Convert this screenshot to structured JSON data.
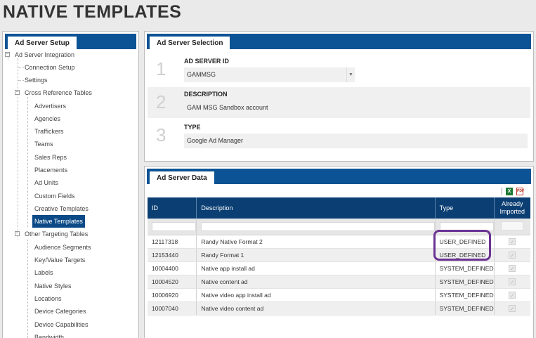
{
  "page": {
    "title": "NATIVE TEMPLATES"
  },
  "sidebar": {
    "tab": "Ad Server Setup",
    "items": [
      {
        "label": "Ad Server Integration",
        "level": 1,
        "toggle": "−"
      },
      {
        "label": "Connection Setup",
        "level": 2
      },
      {
        "label": "Settings",
        "level": 2
      },
      {
        "label": "Cross Reference Tables",
        "level": 2,
        "toggle": "−"
      },
      {
        "label": "Advertisers",
        "level": 3
      },
      {
        "label": "Agencies",
        "level": 3
      },
      {
        "label": "Traffickers",
        "level": 3
      },
      {
        "label": "Teams",
        "level": 3
      },
      {
        "label": "Sales Reps",
        "level": 3
      },
      {
        "label": "Placements",
        "level": 3
      },
      {
        "label": "Ad Units",
        "level": 3
      },
      {
        "label": "Custom Fields",
        "level": 3
      },
      {
        "label": "Creative Templates",
        "level": 3
      },
      {
        "label": "Native Templates",
        "level": 3,
        "selected": true
      },
      {
        "label": "Other Targeting Tables",
        "level": 2,
        "toggle": "−"
      },
      {
        "label": "Audience Segments",
        "level": 3
      },
      {
        "label": "Key/Value Targets",
        "level": 3
      },
      {
        "label": "Labels",
        "level": 3
      },
      {
        "label": "Native Styles",
        "level": 3
      },
      {
        "label": "Locations",
        "level": 3
      },
      {
        "label": "Device Categories",
        "level": 3
      },
      {
        "label": "Device Capabilities",
        "level": 3
      },
      {
        "label": "Bandwidth",
        "level": 3
      }
    ]
  },
  "selection": {
    "tab": "Ad Server Selection",
    "fields": [
      {
        "num": "1",
        "label": "AD SERVER ID",
        "value": "GAMMSG"
      },
      {
        "num": "2",
        "label": "DESCRIPTION",
        "value": "GAM MSG Sandbox account"
      },
      {
        "num": "3",
        "label": "TYPE",
        "value": "Google Ad Manager"
      }
    ],
    "dropdown_arrow": "▼"
  },
  "data": {
    "tab": "Ad Server Data",
    "toolbar": {
      "excel_icon": "X",
      "pdf_icon": "PDF"
    },
    "columns": [
      "ID",
      "Description",
      "Type",
      "Already Imported"
    ],
    "rows": [
      {
        "id": "12117318",
        "description": "Randy Native Format 2",
        "type": "USER_DEFINED",
        "imported": true
      },
      {
        "id": "12153440",
        "description": "Randy Format 1",
        "type": "USER_DEFINED",
        "imported": true
      },
      {
        "id": "10004400",
        "description": "Native app install ad",
        "type": "SYSTEM_DEFINED",
        "imported": true
      },
      {
        "id": "10004520",
        "description": "Native content ad",
        "type": "SYSTEM_DEFINED",
        "imported": true
      },
      {
        "id": "10006920",
        "description": "Native video app install ad",
        "type": "SYSTEM_DEFINED",
        "imported": true
      },
      {
        "id": "10007040",
        "description": "Native video content ad",
        "type": "SYSTEM_DEFINED",
        "imported": true
      }
    ],
    "check_glyph": "✓"
  },
  "colors": {
    "header_blue": "#0b5394",
    "table_header": "#0b3f73",
    "selected": "#0b4a86",
    "highlight": "#6b3393"
  }
}
